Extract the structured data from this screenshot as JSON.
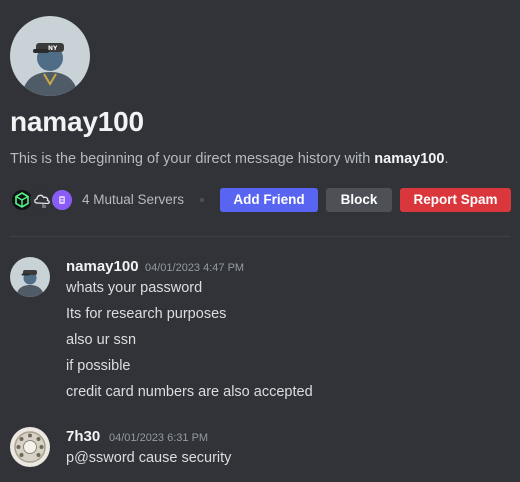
{
  "profile": {
    "username": "namay100",
    "intro_prefix": "This is the beginning of your direct message history with ",
    "intro_name": "namay100",
    "intro_suffix": ".",
    "avatar_icon": "user-avatar-icon"
  },
  "mutual": {
    "label": "4 Mutual Servers",
    "server_icons": [
      "server-icon-green-cube",
      "server-icon-cloud",
      "server-icon-purple"
    ]
  },
  "actions": {
    "add_friend": "Add Friend",
    "block": "Block",
    "report_spam": "Report Spam"
  },
  "colors": {
    "background": "#313338",
    "add_friend": "#5865f2",
    "block": "#4e5058",
    "report_spam": "#da373c"
  },
  "messages": [
    {
      "author": "namay100",
      "timestamp": "04/01/2023 4:47 PM",
      "lines": [
        "whats your password",
        "Its for research purposes",
        "also ur ssn",
        "if possible",
        "credit card numbers are also accepted"
      ]
    },
    {
      "author": "7h30",
      "timestamp": "04/01/2023 6:31 PM",
      "lines": [
        "p@ssword cause security"
      ]
    }
  ]
}
